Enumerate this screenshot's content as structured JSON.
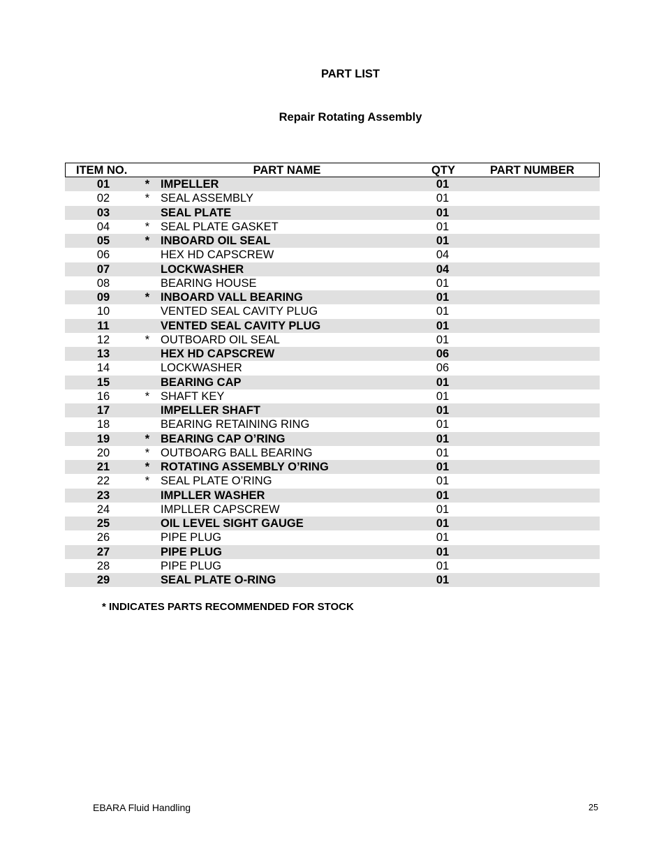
{
  "page": {
    "title": "PART LIST",
    "subtitle": "Repair Rotating Assembly",
    "note": "* INDICATES PARTS RECOMMENDED FOR STOCK",
    "footer_left": "EBARA Fluid Handling",
    "page_number": "25"
  },
  "table": {
    "headers": {
      "item": "ITEM NO.",
      "name": "PART NAME",
      "qty": "QTY",
      "part_number": "PART NUMBER"
    },
    "rows": [
      {
        "item": "01",
        "star": "*",
        "name": "IMPELLER",
        "qty": "01",
        "part_number": ""
      },
      {
        "item": "02",
        "star": "*",
        "name": "SEAL ASSEMBLY",
        "qty": "01",
        "part_number": ""
      },
      {
        "item": "03",
        "star": "",
        "name": "SEAL PLATE",
        "qty": "01",
        "part_number": ""
      },
      {
        "item": "04",
        "star": "*",
        "name": "SEAL PLATE GASKET",
        "qty": "01",
        "part_number": ""
      },
      {
        "item": "05",
        "star": "*",
        "name": "INBOARD OIL SEAL",
        "qty": "01",
        "part_number": ""
      },
      {
        "item": "06",
        "star": "",
        "name": "HEX HD CAPSCREW",
        "qty": "04",
        "part_number": ""
      },
      {
        "item": "07",
        "star": "",
        "name": "LOCKWASHER",
        "qty": "04",
        "part_number": ""
      },
      {
        "item": "08",
        "star": "",
        "name": "BEARING HOUSE",
        "qty": "01",
        "part_number": ""
      },
      {
        "item": "09",
        "star": "*",
        "name": "INBOARD VALL BEARING",
        "qty": "01",
        "part_number": ""
      },
      {
        "item": "10",
        "star": "",
        "name": "VENTED SEAL CAVITY PLUG",
        "qty": "01",
        "part_number": ""
      },
      {
        "item": "11",
        "star": "",
        "name": "VENTED SEAL CAVITY PLUG",
        "qty": "01",
        "part_number": ""
      },
      {
        "item": "12",
        "star": "*",
        "name": "OUTBOARD OIL SEAL",
        "qty": "01",
        "part_number": ""
      },
      {
        "item": "13",
        "star": "",
        "name": "HEX HD CAPSCREW",
        "qty": "06",
        "part_number": ""
      },
      {
        "item": "14",
        "star": "",
        "name": "LOCKWASHER",
        "qty": "06",
        "part_number": ""
      },
      {
        "item": "15",
        "star": "",
        "name": "BEARING CAP",
        "qty": "01",
        "part_number": ""
      },
      {
        "item": "16",
        "star": "*",
        "name": "SHAFT KEY",
        "qty": "01",
        "part_number": ""
      },
      {
        "item": "17",
        "star": "",
        "name": "IMPELLER SHAFT",
        "qty": "01",
        "part_number": ""
      },
      {
        "item": "18",
        "star": "",
        "name": "BEARING RETAINING RING",
        "qty": "01",
        "part_number": ""
      },
      {
        "item": "19",
        "star": "*",
        "name": "BEARING CAP O’RING",
        "qty": "01",
        "part_number": ""
      },
      {
        "item": "20",
        "star": "*",
        "name": "OUTBOARG BALL BEARING",
        "qty": "01",
        "part_number": ""
      },
      {
        "item": "21",
        "star": "*",
        "name": "ROTATING ASSEMBLY O’RING",
        "qty": "01",
        "part_number": ""
      },
      {
        "item": "22",
        "star": "*",
        "name": "SEAL PLATE O’RING",
        "qty": "01",
        "part_number": ""
      },
      {
        "item": "23",
        "star": "",
        "name": "IMPLLER WASHER",
        "qty": "01",
        "part_number": ""
      },
      {
        "item": "24",
        "star": "",
        "name": "IMPLLER CAPSCREW",
        "qty": "01",
        "part_number": ""
      },
      {
        "item": "25",
        "star": "",
        "name": "OIL LEVEL SIGHT GAUGE",
        "qty": "01",
        "part_number": ""
      },
      {
        "item": "26",
        "star": "",
        "name": "PIPE PLUG",
        "qty": "01",
        "part_number": ""
      },
      {
        "item": "27",
        "star": "",
        "name": "PIPE PLUG",
        "qty": "01",
        "part_number": ""
      },
      {
        "item": "28",
        "star": "",
        "name": "PIPE PLUG",
        "qty": "01",
        "part_number": ""
      },
      {
        "item": "29",
        "star": "",
        "name": "SEAL PLATE O-RING",
        "qty": "01",
        "part_number": ""
      }
    ]
  },
  "colors": {
    "row_shade": "#e0e0e0",
    "text": "#000000"
  }
}
